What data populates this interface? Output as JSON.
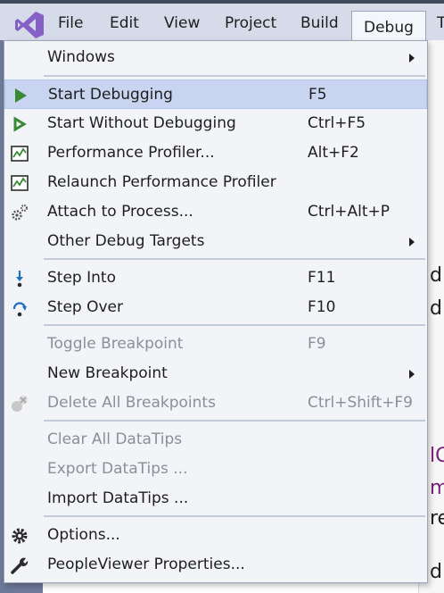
{
  "menubar": {
    "items": [
      "File",
      "Edit",
      "View",
      "Project",
      "Build",
      "Debug",
      "T"
    ],
    "active": "Debug"
  },
  "background": {
    "fragments": [
      "d",
      "d",
      "lC",
      "m",
      "re",
      "d"
    ],
    "fragment_colors": [
      "#1e1e1e",
      "#1e1e1e",
      "#7a1f7a",
      "#7a1f7a",
      "#1e1e1e",
      "#1e1e1e"
    ]
  },
  "menu": {
    "windows": {
      "label": "Windows"
    },
    "start_debugging": {
      "label": "Start Debugging",
      "shortcut": "F5"
    },
    "start_without_debugging": {
      "label": "Start Without Debugging",
      "shortcut": "Ctrl+F5"
    },
    "performance_profiler": {
      "label": "Performance Profiler...",
      "shortcut": "Alt+F2"
    },
    "relaunch_profiler": {
      "label": "Relaunch Performance Profiler"
    },
    "attach_to_process": {
      "label": "Attach to Process...",
      "shortcut": "Ctrl+Alt+P"
    },
    "other_debug_targets": {
      "label": "Other Debug Targets"
    },
    "step_into": {
      "label": "Step Into",
      "shortcut": "F11"
    },
    "step_over": {
      "label": "Step Over",
      "shortcut": "F10"
    },
    "toggle_breakpoint": {
      "label": "Toggle Breakpoint",
      "shortcut": "F9"
    },
    "new_breakpoint": {
      "label": "New Breakpoint"
    },
    "delete_all_breakpoints": {
      "label": "Delete All Breakpoints",
      "shortcut": "Ctrl+Shift+F9"
    },
    "clear_all_datatips": {
      "label": "Clear All DataTips"
    },
    "export_datatips": {
      "label": "Export DataTips ..."
    },
    "import_datatips": {
      "label": "Import DataTips ..."
    },
    "options": {
      "label": "Options..."
    },
    "properties": {
      "label": "PeopleViewer Properties..."
    }
  },
  "colors": {
    "accent_purple": "#8661c5",
    "play_green": "#388a34",
    "step_blue": "#1e6fc0",
    "highlight": "#c9d5f0"
  },
  "icons": {
    "start": "play-icon",
    "start_without": "play-outline-icon",
    "profiler": "chart-icon",
    "attach": "gears-icon",
    "step_into": "step-into-icon",
    "step_over": "step-over-icon",
    "delete_bp": "breakpoints-icon",
    "options": "gear-icon",
    "properties": "wrench-icon"
  }
}
